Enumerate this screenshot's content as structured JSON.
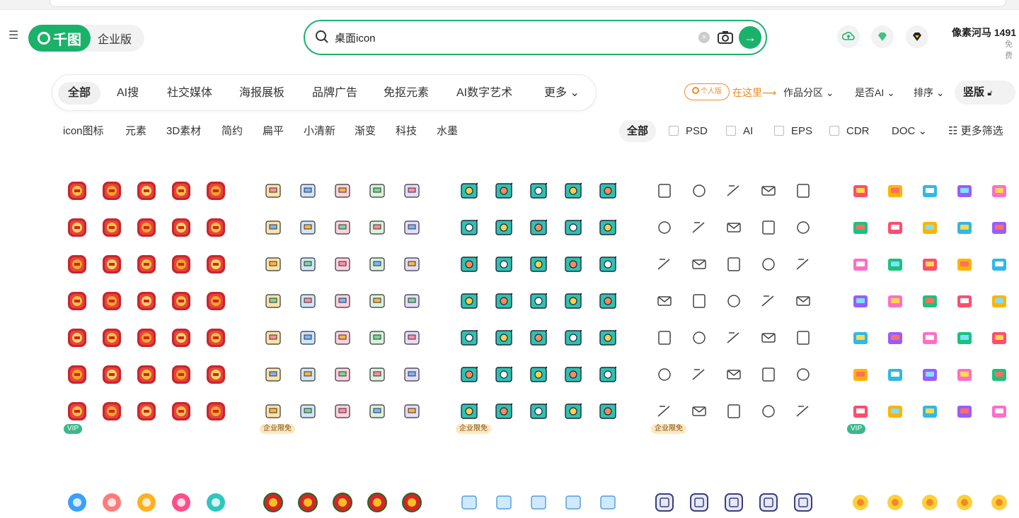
{
  "search": {
    "query": "桌面icon"
  },
  "logo": {
    "brand": "千图",
    "edition": "企业版"
  },
  "user": {
    "name": "像素河马 1491",
    "sub": "免费"
  },
  "categories": [
    "全部",
    "AI搜",
    "社交媒体",
    "海报展板",
    "品牌广告",
    "免抠元素",
    "AI数字艺术",
    "更多"
  ],
  "right_filters": {
    "personal": "个人版",
    "here": "在这里",
    "zone": "作品分区",
    "is_ai": "是否AI",
    "sort": "排序",
    "vertical": "竖版"
  },
  "tags": [
    "icon图标",
    "元素",
    "3D素材",
    "简约",
    "扁平",
    "小清新",
    "渐变",
    "科技",
    "水墨"
  ],
  "formats": {
    "all": "全部",
    "items": [
      "PSD",
      "AI",
      "EPS",
      "CDR"
    ],
    "doc": "DOC",
    "more": "更多筛选"
  },
  "cards": [
    {
      "badge": "VIP",
      "badge_type": "vip",
      "style": "red"
    },
    {
      "badge": "企业限免",
      "badge_type": "ent",
      "style": "pastel"
    },
    {
      "badge": "企业限免",
      "badge_type": "ent",
      "style": "teal"
    },
    {
      "badge": "企业限免",
      "badge_type": "ent",
      "style": "line"
    },
    {
      "badge": "VIP",
      "badge_type": "vip",
      "style": "bright"
    }
  ],
  "card_row_digit": "25",
  "colors": {
    "brand_green": "#1ab26b",
    "orange": "#f08a24",
    "vip": "#39b88a"
  }
}
